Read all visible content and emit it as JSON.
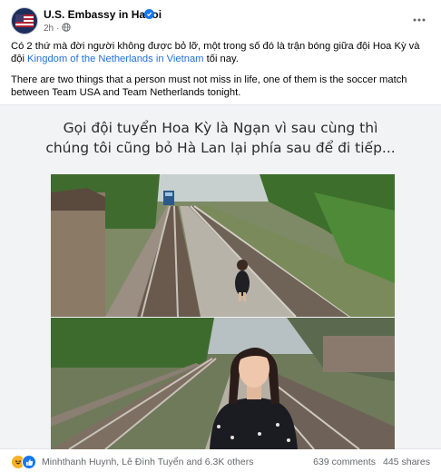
{
  "post": {
    "page_name": "U.S. Embassy in Hanoi",
    "time": "2h",
    "text_vi_before_link": "Có 2 thứ mà đời người không được bỏ lỡ, một trong số đó là trận bóng giữa đội Hoa Kỳ và đội",
    "text_vi_link": "Kingdom of the Netherlands in Vietnam",
    "text_vi_after_link": " tối nay.",
    "text_en": "There are two things that a person must not miss in life, one of them is the soccer match between Team USA and Team Netherlands tonight."
  },
  "media": {
    "caption_line1": "Gọi đội tuyển Hoa Kỳ là Ngạn vì sau cùng thì",
    "caption_line2": "chúng tôi cũng bỏ Hà Lan lại phía sau để đi tiếp..."
  },
  "footer": {
    "reactions_names": "Minhthanh Huynh, Lê Đình Tuyển and 6.3K others",
    "comments": "639 comments",
    "shares": "445 shares"
  },
  "icons": {
    "avatar": "us-flag-icon",
    "verified": "verified-badge-icon",
    "privacy": "globe-icon",
    "more": "more-options-icon",
    "reaction_1": "haha-reaction-icon",
    "reaction_2": "like-reaction-icon"
  },
  "colors": {
    "link": "#216fdb",
    "verified": "#1877f2",
    "secondary_text": "#65676b"
  }
}
